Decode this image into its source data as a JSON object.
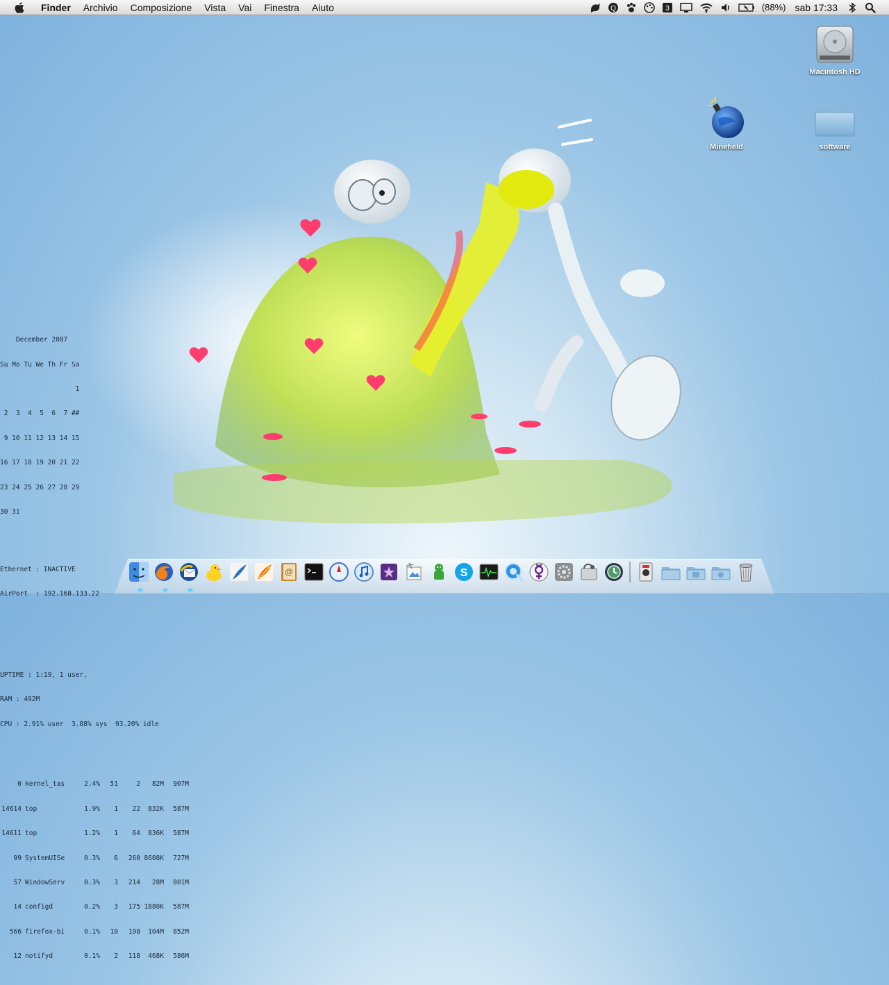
{
  "menubar": {
    "app_name": "Finder",
    "items": [
      "Archivio",
      "Composizione",
      "Vista",
      "Vai",
      "Finestra",
      "Aiuto"
    ],
    "battery_text": "(88%)",
    "clock": "sab 17:33",
    "icons": [
      "growl-icon",
      "quicksilver-icon",
      "paw-icon",
      "palette-icon",
      "trisector-icon",
      "display-icon",
      "wifi-icon",
      "volume-icon",
      "battery-icon",
      "bluetooth-icon",
      "spotlight-icon"
    ]
  },
  "desktop": {
    "icons": [
      {
        "label": "Macintosh HD",
        "icon": "hard-drive-icon"
      },
      {
        "label": "Minefield",
        "icon": "minefield-icon"
      },
      {
        "label": "software",
        "icon": "folder-icon"
      }
    ]
  },
  "geektool": {
    "calendar": [
      "    December 2007",
      "Su Mo Tu We Th Fr Sa",
      "                   1",
      " 2  3  4  5  6  7 ##",
      " 9 10 11 12 13 14 15",
      "16 17 18 19 20 21 22",
      "23 24 25 26 27 28 29",
      "30 31"
    ],
    "network": [
      "Ethernet : INACTIVE",
      "AirPort  : 192.168.133.22"
    ],
    "system": [
      "UPTIME : 1:19, 1 user,",
      "RAM : 492M",
      "CPU : 2.91% user  3.88% sys  93.20% idle"
    ],
    "processes": [
      [
        "0",
        "kernel_tas",
        "2.4%",
        "51",
        "2",
        "82M",
        "907M"
      ],
      [
        "14614",
        "top",
        "1.9%",
        "1",
        "22",
        "832K",
        "587M"
      ],
      [
        "14611",
        "top",
        "1.2%",
        "1",
        "64",
        "836K",
        "587M"
      ],
      [
        "99",
        "SystemUISe",
        "0.3%",
        "6",
        "260",
        "8608K",
        "727M"
      ],
      [
        "57",
        "WindowServ",
        "0.3%",
        "3",
        "214",
        "28M",
        "801M"
      ],
      [
        "14",
        "configd",
        "0.2%",
        "3",
        "175",
        "1880K",
        "587M"
      ],
      [
        "566",
        "firefox-bi",
        "0.1%",
        "10",
        "198",
        "104M",
        "852M"
      ],
      [
        "12",
        "notifyd",
        "0.1%",
        "2",
        "118",
        "468K",
        "586M"
      ]
    ]
  },
  "dock": {
    "apps": [
      "finder-icon",
      "firefox-icon",
      "thunderbird-icon",
      "adium-icon",
      "feather-icon",
      "pen-icon",
      "address-book-icon",
      "terminal-icon",
      "safari-icon",
      "itunes-icon",
      "photo-icon",
      "preview-icon",
      "android-icon",
      "skype-icon",
      "activity-monitor-icon",
      "quicktime-icon",
      "venus-icon",
      "system-prefs-icon",
      "disk-utility-icon",
      "time-machine-icon"
    ],
    "stacks": [
      "camera-icon",
      "folder-stack-icon",
      "documents-stack-icon",
      "downloads-stack-icon",
      "trash-icon"
    ]
  }
}
